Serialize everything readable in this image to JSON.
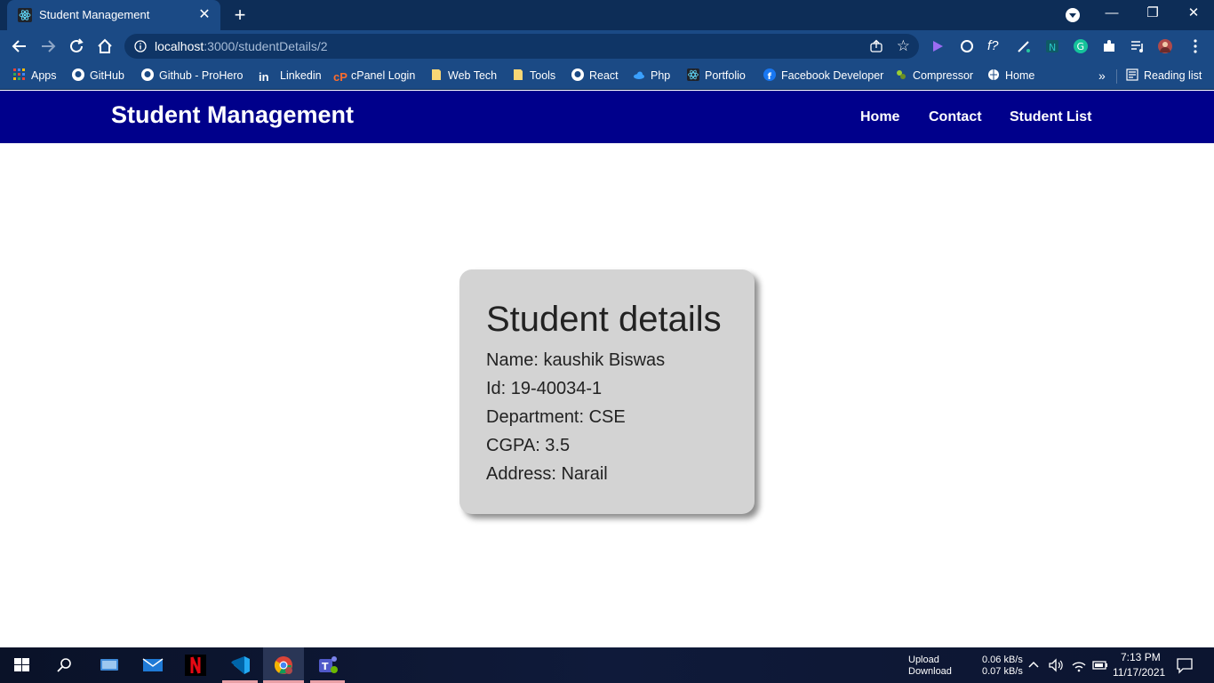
{
  "browser": {
    "tab_title": "Student Management",
    "url_host": "localhost",
    "url_path": ":3000/studentDetails/2",
    "bookmarks": [
      "Apps",
      "GitHub",
      "Github - ProHero",
      "Linkedin",
      "cPanel Login",
      "Web Tech",
      "Tools",
      "React",
      "Php",
      "Portfolio",
      "Facebook Developer",
      "Compressor",
      "Home"
    ],
    "more_label": "»",
    "reading_list": "Reading list"
  },
  "app": {
    "brand": "Student Management",
    "nav": [
      "Home",
      "Contact",
      "Student List"
    ]
  },
  "student": {
    "heading": "Student details",
    "name": "Name: kaushik Biswas",
    "id": "Id: 19-40034-1",
    "department": "Department: CSE",
    "cgpa": "CGPA: 3.5",
    "address": "Address: Narail"
  },
  "taskbar": {
    "upload_label": "Upload",
    "download_label": "Download",
    "upload_speed": "0.06 kB/s",
    "download_speed": "0.07 kB/s",
    "time": "7:13 PM",
    "date": "11/17/2021"
  },
  "colors": {
    "navbar": "#00008b",
    "card": "#d3d3d3",
    "chrome_frame": "#1b4a85"
  }
}
